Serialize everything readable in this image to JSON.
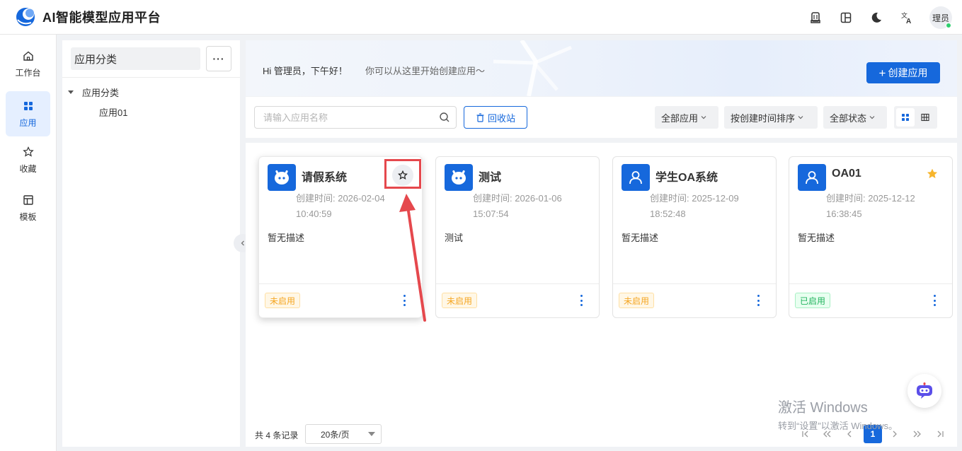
{
  "app": {
    "title": "AI智能模型应用平台"
  },
  "header": {
    "user_label": "理员"
  },
  "nav": {
    "items": [
      {
        "label": "工作台",
        "icon": "home-icon"
      },
      {
        "label": "应用",
        "icon": "apps-grid-icon",
        "active": true
      },
      {
        "label": "收藏",
        "icon": "star-icon"
      },
      {
        "label": "模板",
        "icon": "template-icon"
      }
    ]
  },
  "category": {
    "header_label": "应用分类",
    "more_label": "···",
    "tree": {
      "root": "应用分类",
      "children": [
        "应用01"
      ]
    }
  },
  "banner": {
    "greeting": "Hi 管理员，下午好！",
    "hint": "你可以从这里开始创建应用～",
    "create_label": "创建应用"
  },
  "filters": {
    "search_placeholder": "请输入应用名称",
    "recycle_label": "回收站",
    "type_filter": "全部应用",
    "sort_filter": "按创建时间排序",
    "status_filter": "全部状态"
  },
  "apps": [
    {
      "name": "请假系统",
      "created_label": "创建时间: 2026-02-04",
      "created_time": "10:40:59",
      "description": "暂无描述",
      "status": "未启用",
      "enabled": false,
      "favorite": false,
      "icon": "robot-icon"
    },
    {
      "name": "测试",
      "created_label": "创建时间: 2026-01-06",
      "created_time": "15:07:54",
      "description": "测试",
      "status": "未启用",
      "enabled": false,
      "favorite": false,
      "icon": "robot-icon"
    },
    {
      "name": "学生OA系统",
      "created_label": "创建时间: 2025-12-09",
      "created_time": "18:52:48",
      "description": "暂无描述",
      "status": "未启用",
      "enabled": false,
      "favorite": false,
      "icon": "user-icon"
    },
    {
      "name": "OA01",
      "created_label": "创建时间: 2025-12-12",
      "created_time": "16:38:45",
      "description": "暂无描述",
      "status": "已启用",
      "enabled": true,
      "favorite": true,
      "icon": "user-icon"
    }
  ],
  "pagination": {
    "total_label": "共 4 条记录",
    "page_size": "20条/页",
    "current_page": "1"
  },
  "watermark": {
    "line1": "激活 Windows",
    "line2": "转到“设置”以激活 Windows。"
  },
  "colors": {
    "primary": "#1668dc",
    "disabled_badge": "#f5a623",
    "enabled_badge": "#22b35e",
    "annotation": "#e5484d",
    "favorite_star": "#f7b52c"
  }
}
